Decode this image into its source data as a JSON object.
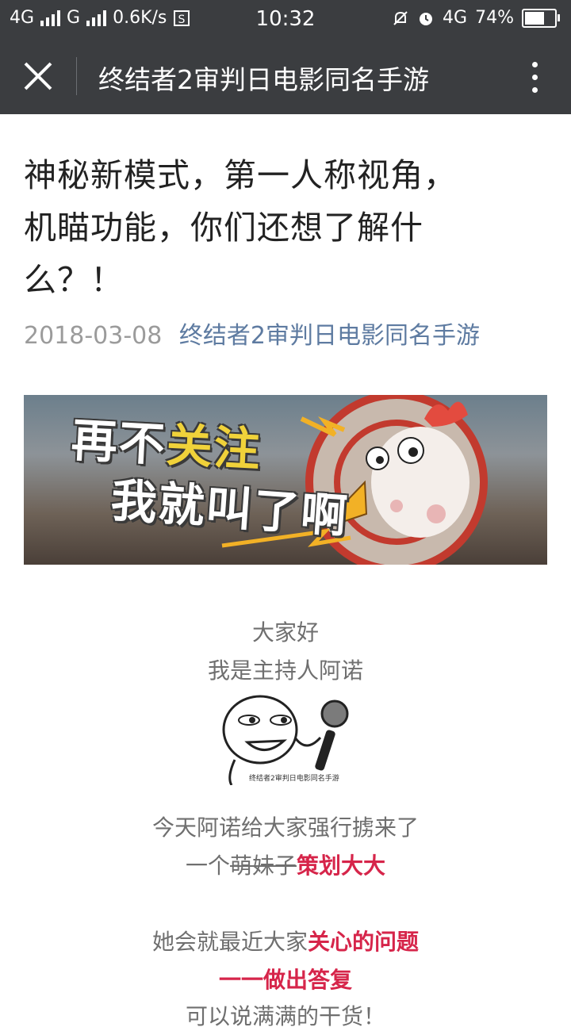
{
  "status_bar": {
    "net1": "4G",
    "net2": "G",
    "speed": "0.6K/s",
    "time": "10:32",
    "net3": "4G",
    "battery": "74%",
    "battery_level": 0.74
  },
  "navbar": {
    "title": "终结者2审判日电影同名手游"
  },
  "article": {
    "title_line1": "神秘新模式，第一人称视角，",
    "title_line2": "机瞄功能，你们还想了解什",
    "title_line3": "么？！",
    "date": "2018-03-08",
    "author": "终结者2审判日电影同名手游"
  },
  "banner": {
    "line1_white": "再不",
    "line1_yellow": "关注",
    "line2": "我就叫了啊"
  },
  "body": {
    "p1": "大家好",
    "p2": "我是主持人阿诺",
    "meme_watermark": "终结者2审判日电影同名手游",
    "p3": "今天阿诺给大家强行掳来了",
    "p4_prefix": "一个",
    "p4_strike": "萌妹子",
    "p4_red": "策划大大",
    "p5_prefix": "她会就最近大家",
    "p5_red": "关心的问题",
    "p6_red": "一一做出答复",
    "p7": "可以说满满的干货！"
  },
  "colors": {
    "bar_bg": "#3b3d40",
    "accent_red": "#d6254a",
    "link_blue": "#5e7ba1"
  }
}
